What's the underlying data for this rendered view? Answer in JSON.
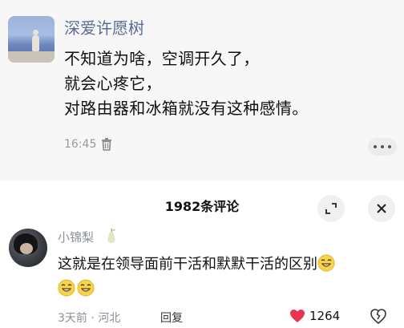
{
  "post": {
    "author": "深爱许愿树",
    "content": "不知道为啥，空调开久了，\n就会心疼它，\n对路由器和冰箱就没有这种感情。",
    "time": "16:45",
    "icons": {
      "delete": "trash-icon",
      "more": "more-icon"
    }
  },
  "comments_panel": {
    "title": "1982条评论",
    "icons": {
      "expand": "expand-icon",
      "close": "close-icon"
    }
  },
  "comment": {
    "user": "小锦梨",
    "text": "这就是在领导面前干活和默默干活的区别",
    "emoji": "smile-emoji",
    "meta": "3天前 · 河北",
    "reply_label": "回复",
    "likes": "1264",
    "colors": {
      "like": "#e8344e"
    }
  }
}
